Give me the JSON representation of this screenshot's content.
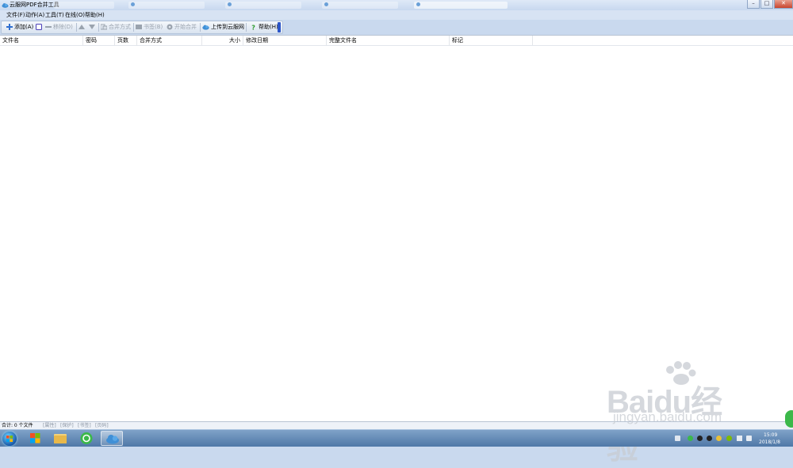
{
  "window": {
    "title": "云服网PDF合并工具",
    "controls": {
      "minimize": "–",
      "maximize": "□",
      "close": "✕"
    }
  },
  "menu": [
    {
      "label": "文件(F)"
    },
    {
      "label": "动作(A)"
    },
    {
      "label": "工具(T)"
    },
    {
      "label": "在线(O)"
    },
    {
      "label": "帮助(H)"
    }
  ],
  "toolbar": {
    "add": "添加(A)",
    "remove": "移除(D)",
    "merge_mode": "合并方式",
    "bookmark": "书签(B)",
    "start_merge": "开始合并",
    "upload": "上传到云服网",
    "help": "帮助(H)"
  },
  "columns": {
    "filename": "文件名",
    "password": "密码",
    "pages": "页数",
    "merge_mode": "合并方式",
    "size": "大小",
    "modified": "修改日期",
    "fullname": "完整文件名",
    "tag": "标记"
  },
  "status": {
    "total": "合计: 0 个文件",
    "properties": "[属性]",
    "protect": "[保护]",
    "bookmarks": "[书签]",
    "pagecode": "[页码]"
  },
  "taskbar": {
    "time": "15:09",
    "date": "2018/1/8"
  },
  "watermark": {
    "brand": "Baidu经验",
    "url": "jingyan.baidu.com"
  },
  "colors": {
    "titlebar": "#c7d8ef",
    "taskbar": "#4f78a7",
    "accent": "#2b55c8"
  }
}
